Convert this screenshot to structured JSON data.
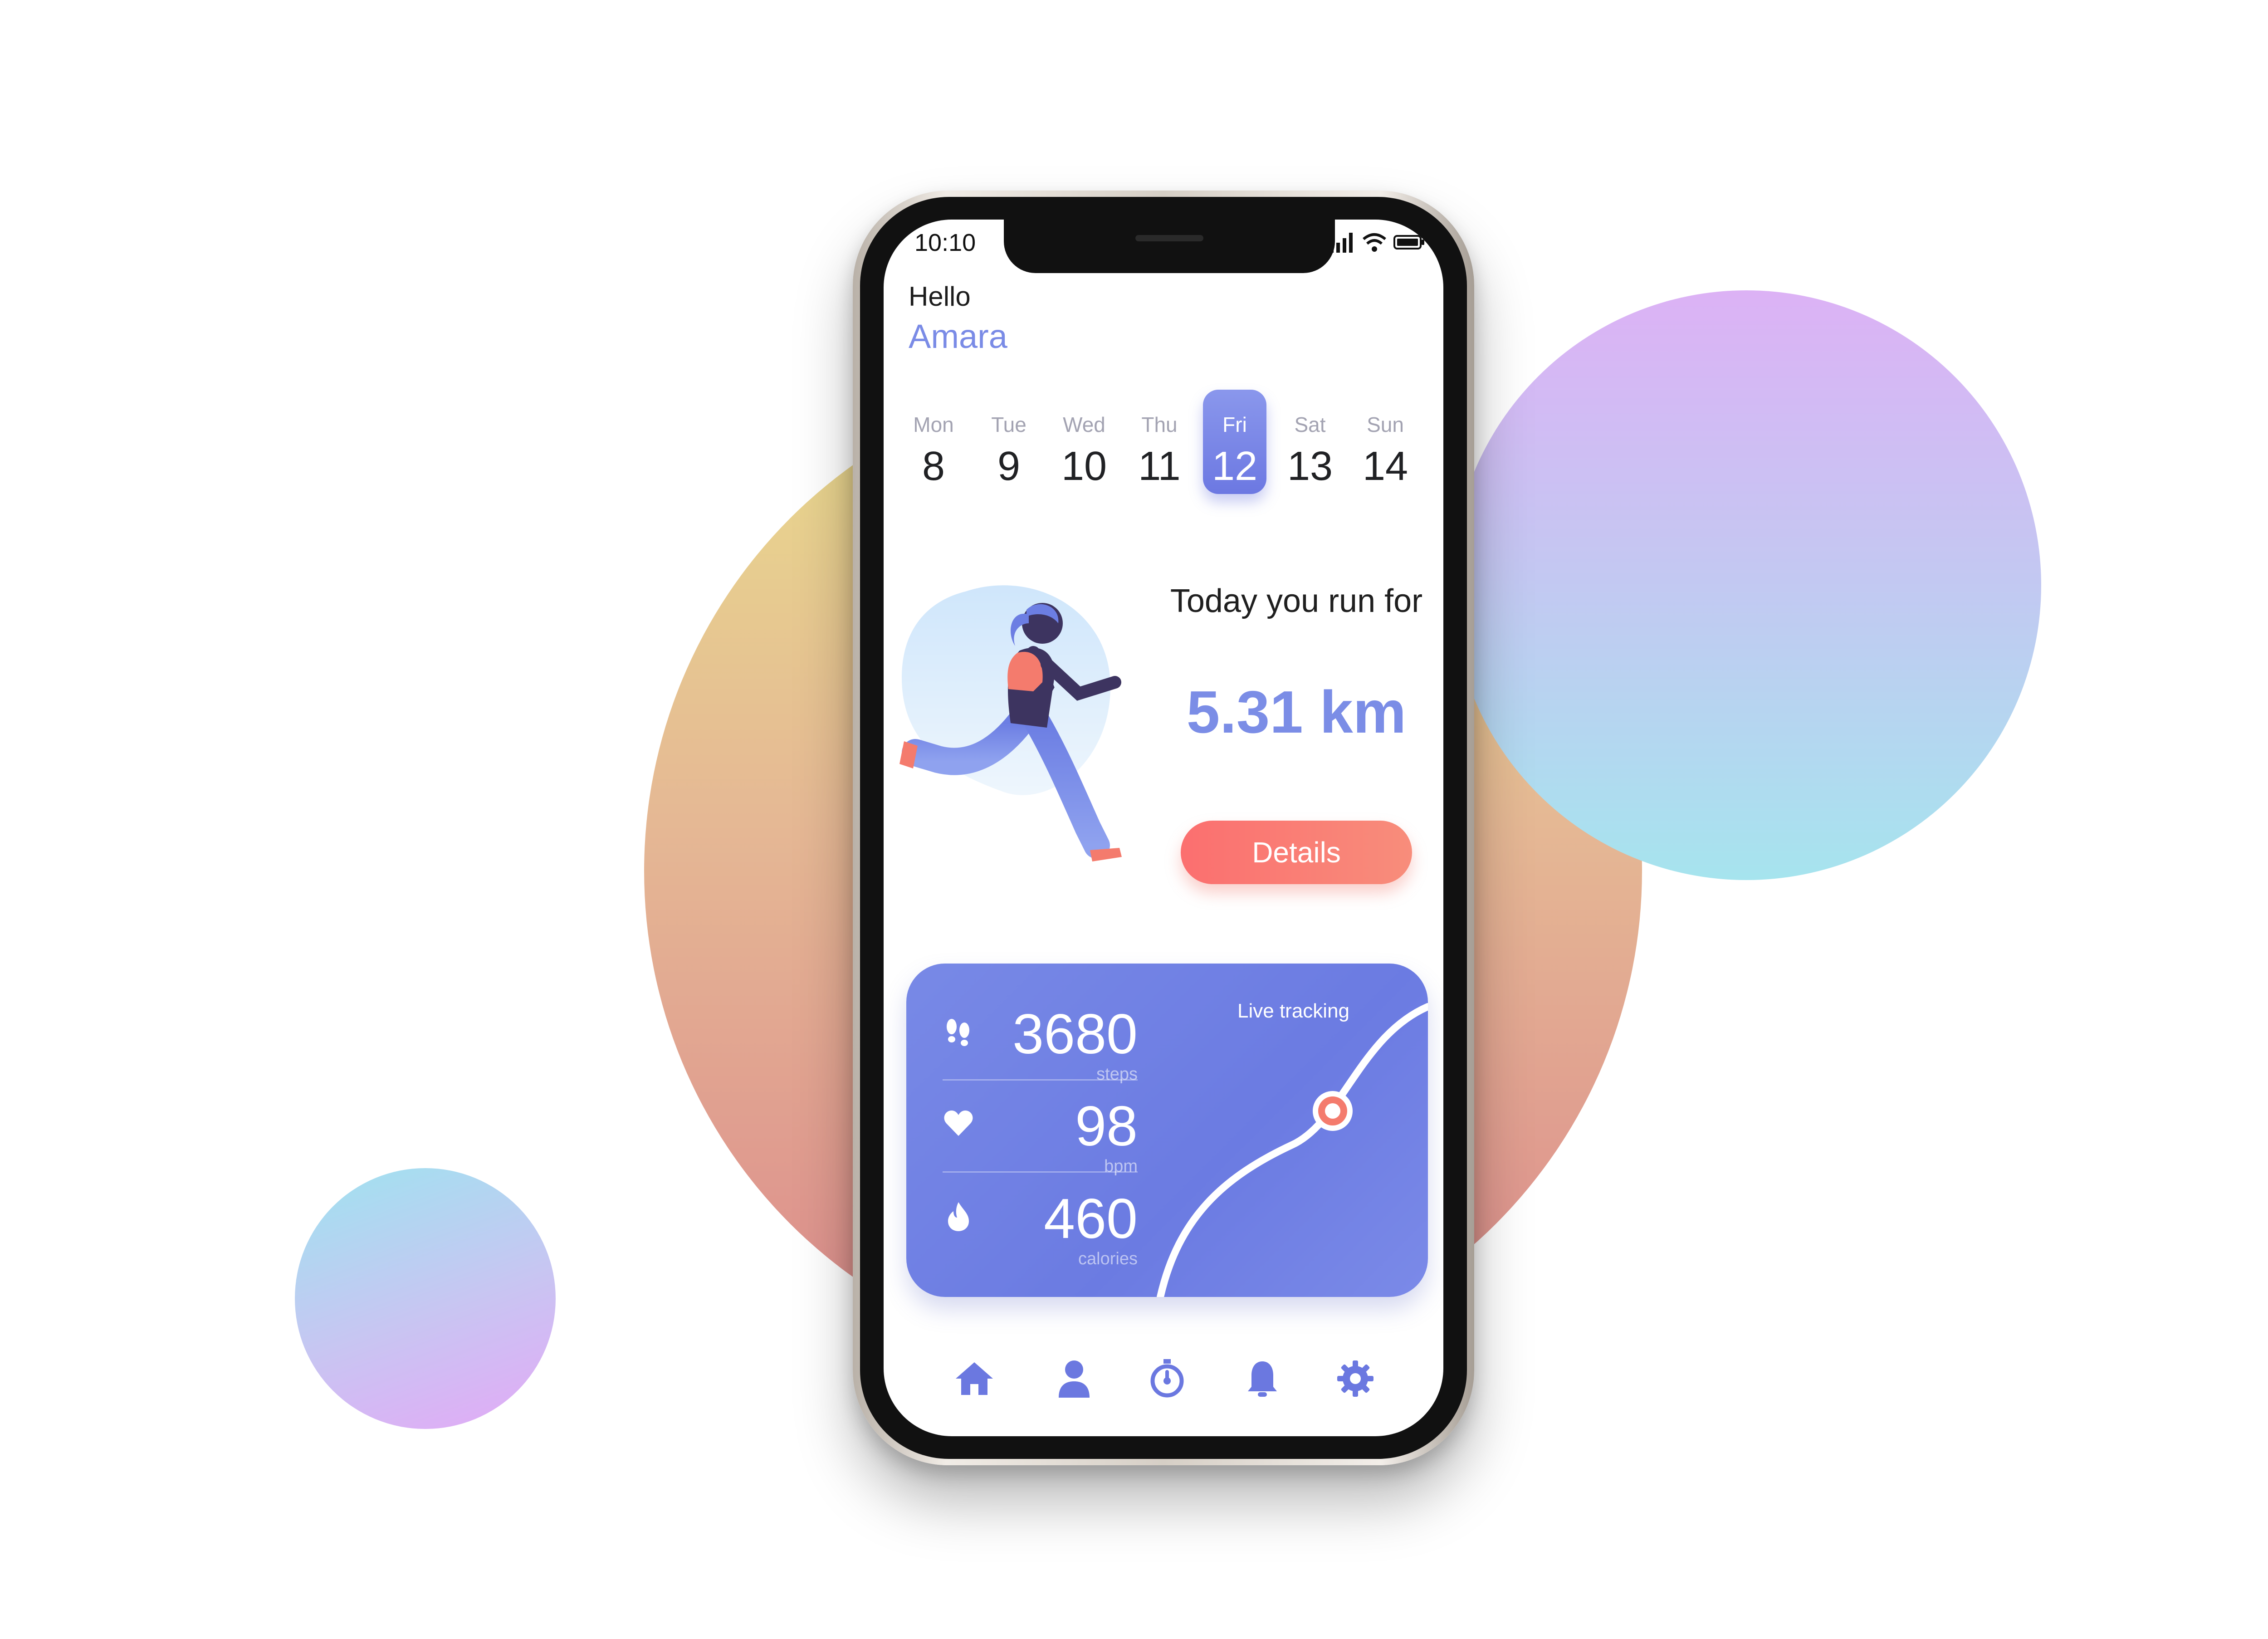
{
  "status_bar": {
    "time": "10:10"
  },
  "greeting": {
    "hello": "Hello",
    "name": "Amara"
  },
  "week": [
    {
      "day": "Mon",
      "date": "8"
    },
    {
      "day": "Tue",
      "date": "9"
    },
    {
      "day": "Wed",
      "date": "10"
    },
    {
      "day": "Thu",
      "date": "11"
    },
    {
      "day": "Fri",
      "date": "12",
      "selected": true
    },
    {
      "day": "Sat",
      "date": "13"
    },
    {
      "day": "Sun",
      "date": "14"
    }
  ],
  "run": {
    "caption": "Today you run for",
    "distance": "5.31 km",
    "details_label": "Details"
  },
  "stats": {
    "steps": {
      "value": "3680",
      "unit": "steps"
    },
    "heart": {
      "value": "98",
      "unit": "bpm"
    },
    "calories": {
      "value": "460",
      "unit": "calories"
    }
  },
  "tracking": {
    "label": "Live tracking"
  },
  "nav": [
    "home-icon",
    "profile-icon",
    "stopwatch-icon",
    "bell-icon",
    "gear-icon"
  ],
  "colors": {
    "accent": "#7b8de6",
    "button": "#fa7a73",
    "card": "#6f7fe3"
  }
}
